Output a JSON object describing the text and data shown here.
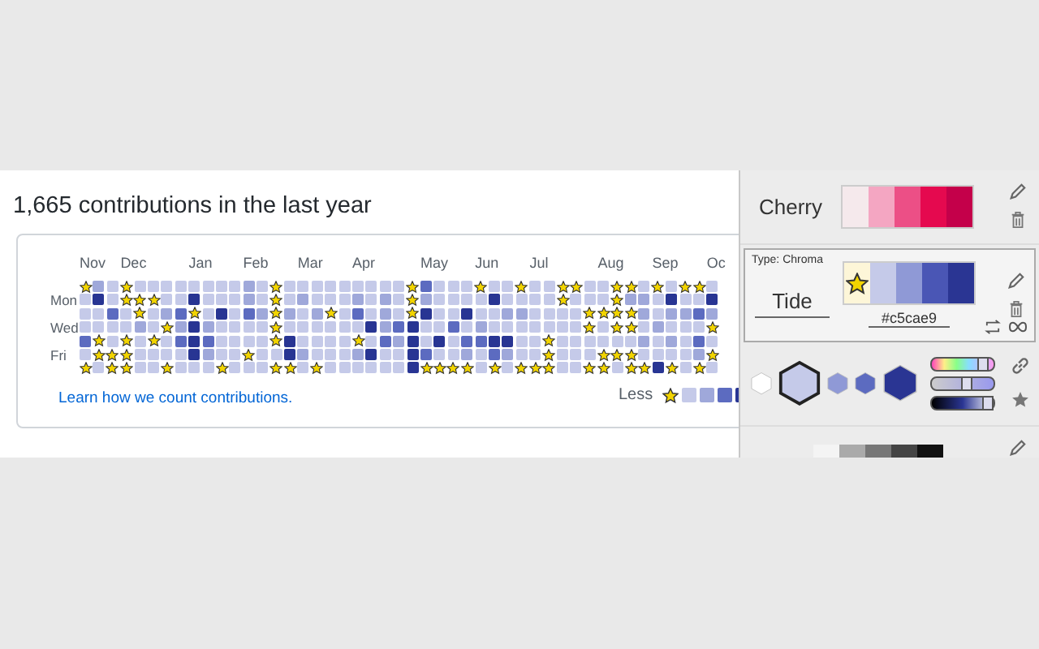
{
  "contributions": {
    "title": "1,665 contributions in the last year",
    "months": [
      "Nov",
      "Dec",
      "Jan",
      "Feb",
      "Mar",
      "Apr",
      "May",
      "Jun",
      "Jul",
      "Aug",
      "Sep",
      "Oc"
    ],
    "days": [
      "Mon",
      "Wed",
      "Fri"
    ],
    "grid": [
      {
        "cells": [
          {
            "kind": "star"
          },
          {
            "kind": "square",
            "color": "#9fa8da"
          },
          {
            "kind": "square",
            "color": "#c5cae9"
          },
          {
            "kind": "star"
          },
          {
            "kind": "square",
            "color": "#c5cae9"
          },
          {
            "kind": "square",
            "color": "#c5cae9"
          },
          {
            "kind": "square",
            "color": "#c5cae9"
          },
          {
            "kind": "square",
            "color": "#c5cae9"
          },
          {
            "kind": "square",
            "color": "#c5cae9"
          },
          {
            "kind": "square",
            "color": "#c5cae9"
          },
          {
            "kind": "square",
            "color": "#c5cae9"
          },
          {
            "kind": "square",
            "color": "#c5cae9"
          },
          {
            "kind": "square",
            "color": "#9fa8da"
          },
          {
            "kind": "square",
            "color": "#c5cae9"
          },
          {
            "kind": "star"
          },
          {
            "kind": "square",
            "color": "#c5cae9"
          },
          {
            "kind": "square",
            "color": "#c5cae9"
          },
          {
            "kind": "square",
            "color": "#c5cae9"
          },
          {
            "kind": "square",
            "color": "#c5cae9"
          },
          {
            "kind": "square",
            "color": "#c5cae9"
          },
          {
            "kind": "square",
            "color": "#c5cae9"
          },
          {
            "kind": "square",
            "color": "#c5cae9"
          },
          {
            "kind": "square",
            "color": "#c5cae9"
          },
          {
            "kind": "square",
            "color": "#c5cae9"
          },
          {
            "kind": "star"
          },
          {
            "kind": "square",
            "color": "#5c6bc0"
          },
          {
            "kind": "square",
            "color": "#c5cae9"
          },
          {
            "kind": "square",
            "color": "#c5cae9"
          },
          {
            "kind": "square",
            "color": "#c5cae9"
          },
          {
            "kind": "star"
          },
          {
            "kind": "square",
            "color": "#c5cae9"
          },
          {
            "kind": "square",
            "color": "#c5cae9"
          },
          {
            "kind": "star"
          },
          {
            "kind": "square",
            "color": "#c5cae9"
          },
          {
            "kind": "square",
            "color": "#c5cae9"
          },
          {
            "kind": "star"
          },
          {
            "kind": "star"
          },
          {
            "kind": "square",
            "color": "#c5cae9"
          },
          {
            "kind": "square",
            "color": "#c5cae9"
          },
          {
            "kind": "star"
          },
          {
            "kind": "star"
          },
          {
            "kind": "square",
            "color": "#c5cae9"
          },
          {
            "kind": "star"
          },
          {
            "kind": "square",
            "color": "#c5cae9"
          },
          {
            "kind": "star"
          },
          {
            "kind": "star"
          },
          {
            "kind": "square",
            "color": "#c5cae9"
          }
        ]
      },
      {
        "cells": [
          {
            "kind": "square",
            "color": "#c5cae9"
          },
          {
            "kind": "square",
            "color": "#283593"
          },
          {
            "kind": "square",
            "color": "#c5cae9"
          },
          {
            "kind": "star"
          },
          {
            "kind": "star"
          },
          {
            "kind": "star"
          },
          {
            "kind": "square",
            "color": "#c5cae9"
          },
          {
            "kind": "square",
            "color": "#c5cae9"
          },
          {
            "kind": "square",
            "color": "#283593"
          },
          {
            "kind": "square",
            "color": "#c5cae9"
          },
          {
            "kind": "square",
            "color": "#c5cae9"
          },
          {
            "kind": "square",
            "color": "#c5cae9"
          },
          {
            "kind": "square",
            "color": "#9fa8da"
          },
          {
            "kind": "square",
            "color": "#c5cae9"
          },
          {
            "kind": "star"
          },
          {
            "kind": "square",
            "color": "#c5cae9"
          },
          {
            "kind": "square",
            "color": "#9fa8da"
          },
          {
            "kind": "square",
            "color": "#c5cae9"
          },
          {
            "kind": "square",
            "color": "#c5cae9"
          },
          {
            "kind": "square",
            "color": "#c5cae9"
          },
          {
            "kind": "square",
            "color": "#9fa8da"
          },
          {
            "kind": "square",
            "color": "#c5cae9"
          },
          {
            "kind": "square",
            "color": "#9fa8da"
          },
          {
            "kind": "square",
            "color": "#c5cae9"
          },
          {
            "kind": "star"
          },
          {
            "kind": "square",
            "color": "#9fa8da"
          },
          {
            "kind": "square",
            "color": "#c5cae9"
          },
          {
            "kind": "square",
            "color": "#c5cae9"
          },
          {
            "kind": "square",
            "color": "#c5cae9"
          },
          {
            "kind": "square",
            "color": "#c5cae9"
          },
          {
            "kind": "square",
            "color": "#283593"
          },
          {
            "kind": "square",
            "color": "#c5cae9"
          },
          {
            "kind": "square",
            "color": "#c5cae9"
          },
          {
            "kind": "square",
            "color": "#c5cae9"
          },
          {
            "kind": "square",
            "color": "#c5cae9"
          },
          {
            "kind": "star"
          },
          {
            "kind": "square",
            "color": "#c5cae9"
          },
          {
            "kind": "square",
            "color": "#c5cae9"
          },
          {
            "kind": "square",
            "color": "#c5cae9"
          },
          {
            "kind": "star"
          },
          {
            "kind": "square",
            "color": "#9fa8da"
          },
          {
            "kind": "square",
            "color": "#9fa8da"
          },
          {
            "kind": "square",
            "color": "#c5cae9"
          },
          {
            "kind": "square",
            "color": "#283593"
          },
          {
            "kind": "square",
            "color": "#c5cae9"
          },
          {
            "kind": "square",
            "color": "#c5cae9"
          },
          {
            "kind": "square",
            "color": "#283593"
          }
        ]
      },
      {
        "cells": [
          {
            "kind": "square",
            "color": "#c5cae9"
          },
          {
            "kind": "square",
            "color": "#c5cae9"
          },
          {
            "kind": "square",
            "color": "#5c6bc0"
          },
          {
            "kind": "square",
            "color": "#c5cae9"
          },
          {
            "kind": "star"
          },
          {
            "kind": "square",
            "color": "#c5cae9"
          },
          {
            "kind": "square",
            "color": "#9fa8da"
          },
          {
            "kind": "square",
            "color": "#5c6bc0"
          },
          {
            "kind": "star"
          },
          {
            "kind": "square",
            "color": "#c5cae9"
          },
          {
            "kind": "square",
            "color": "#283593"
          },
          {
            "kind": "square",
            "color": "#c5cae9"
          },
          {
            "kind": "square",
            "color": "#5c6bc0"
          },
          {
            "kind": "square",
            "color": "#9fa8da"
          },
          {
            "kind": "star"
          },
          {
            "kind": "square",
            "color": "#9fa8da"
          },
          {
            "kind": "square",
            "color": "#c5cae9"
          },
          {
            "kind": "square",
            "color": "#9fa8da"
          },
          {
            "kind": "star"
          },
          {
            "kind": "square",
            "color": "#c5cae9"
          },
          {
            "kind": "square",
            "color": "#5c6bc0"
          },
          {
            "kind": "square",
            "color": "#c5cae9"
          },
          {
            "kind": "square",
            "color": "#9fa8da"
          },
          {
            "kind": "square",
            "color": "#c5cae9"
          },
          {
            "kind": "star"
          },
          {
            "kind": "square",
            "color": "#283593"
          },
          {
            "kind": "square",
            "color": "#c5cae9"
          },
          {
            "kind": "square",
            "color": "#c5cae9"
          },
          {
            "kind": "square",
            "color": "#283593"
          },
          {
            "kind": "square",
            "color": "#c5cae9"
          },
          {
            "kind": "square",
            "color": "#c5cae9"
          },
          {
            "kind": "square",
            "color": "#9fa8da"
          },
          {
            "kind": "square",
            "color": "#9fa8da"
          },
          {
            "kind": "square",
            "color": "#c5cae9"
          },
          {
            "kind": "square",
            "color": "#c5cae9"
          },
          {
            "kind": "square",
            "color": "#c5cae9"
          },
          {
            "kind": "square",
            "color": "#c5cae9"
          },
          {
            "kind": "star"
          },
          {
            "kind": "star"
          },
          {
            "kind": "star"
          },
          {
            "kind": "star"
          },
          {
            "kind": "square",
            "color": "#9fa8da"
          },
          {
            "kind": "square",
            "color": "#c5cae9"
          },
          {
            "kind": "square",
            "color": "#9fa8da"
          },
          {
            "kind": "square",
            "color": "#9fa8da"
          },
          {
            "kind": "square",
            "color": "#5c6bc0"
          },
          {
            "kind": "square",
            "color": "#9fa8da"
          }
        ]
      },
      {
        "cells": [
          {
            "kind": "square",
            "color": "#c5cae9"
          },
          {
            "kind": "square",
            "color": "#c5cae9"
          },
          {
            "kind": "square",
            "color": "#c5cae9"
          },
          {
            "kind": "square",
            "color": "#c5cae9"
          },
          {
            "kind": "square",
            "color": "#9fa8da"
          },
          {
            "kind": "square",
            "color": "#c5cae9"
          },
          {
            "kind": "star"
          },
          {
            "kind": "square",
            "color": "#9fa8da"
          },
          {
            "kind": "square",
            "color": "#283593"
          },
          {
            "kind": "square",
            "color": "#9fa8da"
          },
          {
            "kind": "square",
            "color": "#c5cae9"
          },
          {
            "kind": "square",
            "color": "#c5cae9"
          },
          {
            "kind": "square",
            "color": "#c5cae9"
          },
          {
            "kind": "square",
            "color": "#c5cae9"
          },
          {
            "kind": "star"
          },
          {
            "kind": "square",
            "color": "#c5cae9"
          },
          {
            "kind": "square",
            "color": "#c5cae9"
          },
          {
            "kind": "square",
            "color": "#c5cae9"
          },
          {
            "kind": "square",
            "color": "#c5cae9"
          },
          {
            "kind": "square",
            "color": "#c5cae9"
          },
          {
            "kind": "square",
            "color": "#c5cae9"
          },
          {
            "kind": "square",
            "color": "#283593"
          },
          {
            "kind": "square",
            "color": "#9fa8da"
          },
          {
            "kind": "square",
            "color": "#5c6bc0"
          },
          {
            "kind": "square",
            "color": "#283593"
          },
          {
            "kind": "square",
            "color": "#c5cae9"
          },
          {
            "kind": "square",
            "color": "#c5cae9"
          },
          {
            "kind": "square",
            "color": "#5c6bc0"
          },
          {
            "kind": "square",
            "color": "#c5cae9"
          },
          {
            "kind": "square",
            "color": "#9fa8da"
          },
          {
            "kind": "square",
            "color": "#c5cae9"
          },
          {
            "kind": "square",
            "color": "#c5cae9"
          },
          {
            "kind": "square",
            "color": "#c5cae9"
          },
          {
            "kind": "square",
            "color": "#c5cae9"
          },
          {
            "kind": "square",
            "color": "#c5cae9"
          },
          {
            "kind": "square",
            "color": "#c5cae9"
          },
          {
            "kind": "square",
            "color": "#c5cae9"
          },
          {
            "kind": "star"
          },
          {
            "kind": "square",
            "color": "#c5cae9"
          },
          {
            "kind": "star"
          },
          {
            "kind": "star"
          },
          {
            "kind": "square",
            "color": "#c5cae9"
          },
          {
            "kind": "square",
            "color": "#9fa8da"
          },
          {
            "kind": "square",
            "color": "#c5cae9"
          },
          {
            "kind": "square",
            "color": "#c5cae9"
          },
          {
            "kind": "square",
            "color": "#c5cae9"
          },
          {
            "kind": "star"
          }
        ]
      },
      {
        "cells": [
          {
            "kind": "square",
            "color": "#5c6bc0"
          },
          {
            "kind": "star"
          },
          {
            "kind": "square",
            "color": "#c5cae9"
          },
          {
            "kind": "star"
          },
          {
            "kind": "square",
            "color": "#c5cae9"
          },
          {
            "kind": "star"
          },
          {
            "kind": "square",
            "color": "#c5cae9"
          },
          {
            "kind": "square",
            "color": "#5c6bc0"
          },
          {
            "kind": "square",
            "color": "#283593"
          },
          {
            "kind": "square",
            "color": "#5c6bc0"
          },
          {
            "kind": "square",
            "color": "#c5cae9"
          },
          {
            "kind": "square",
            "color": "#c5cae9"
          },
          {
            "kind": "square",
            "color": "#c5cae9"
          },
          {
            "kind": "square",
            "color": "#c5cae9"
          },
          {
            "kind": "star"
          },
          {
            "kind": "square",
            "color": "#283593"
          },
          {
            "kind": "square",
            "color": "#c5cae9"
          },
          {
            "kind": "square",
            "color": "#c5cae9"
          },
          {
            "kind": "square",
            "color": "#c5cae9"
          },
          {
            "kind": "square",
            "color": "#c5cae9"
          },
          {
            "kind": "star"
          },
          {
            "kind": "square",
            "color": "#c5cae9"
          },
          {
            "kind": "square",
            "color": "#5c6bc0"
          },
          {
            "kind": "square",
            "color": "#9fa8da"
          },
          {
            "kind": "square",
            "color": "#283593"
          },
          {
            "kind": "square",
            "color": "#c5cae9"
          },
          {
            "kind": "square",
            "color": "#283593"
          },
          {
            "kind": "square",
            "color": "#c5cae9"
          },
          {
            "kind": "square",
            "color": "#5c6bc0"
          },
          {
            "kind": "square",
            "color": "#5c6bc0"
          },
          {
            "kind": "square",
            "color": "#283593"
          },
          {
            "kind": "square",
            "color": "#283593"
          },
          {
            "kind": "square",
            "color": "#c5cae9"
          },
          {
            "kind": "square",
            "color": "#c5cae9"
          },
          {
            "kind": "star"
          },
          {
            "kind": "square",
            "color": "#c5cae9"
          },
          {
            "kind": "square",
            "color": "#c5cae9"
          },
          {
            "kind": "square",
            "color": "#c5cae9"
          },
          {
            "kind": "square",
            "color": "#c5cae9"
          },
          {
            "kind": "square",
            "color": "#c5cae9"
          },
          {
            "kind": "square",
            "color": "#c5cae9"
          },
          {
            "kind": "square",
            "color": "#9fa8da"
          },
          {
            "kind": "square",
            "color": "#c5cae9"
          },
          {
            "kind": "square",
            "color": "#9fa8da"
          },
          {
            "kind": "square",
            "color": "#c5cae9"
          },
          {
            "kind": "square",
            "color": "#5c6bc0"
          },
          {
            "kind": "square",
            "color": "#c5cae9"
          }
        ]
      },
      {
        "cells": [
          {
            "kind": "square",
            "color": "#c5cae9"
          },
          {
            "kind": "star"
          },
          {
            "kind": "star"
          },
          {
            "kind": "star"
          },
          {
            "kind": "square",
            "color": "#c5cae9"
          },
          {
            "kind": "square",
            "color": "#c5cae9"
          },
          {
            "kind": "square",
            "color": "#c5cae9"
          },
          {
            "kind": "square",
            "color": "#c5cae9"
          },
          {
            "kind": "square",
            "color": "#283593"
          },
          {
            "kind": "square",
            "color": "#9fa8da"
          },
          {
            "kind": "square",
            "color": "#c5cae9"
          },
          {
            "kind": "square",
            "color": "#c5cae9"
          },
          {
            "kind": "star"
          },
          {
            "kind": "square",
            "color": "#c5cae9"
          },
          {
            "kind": "square",
            "color": "#c5cae9"
          },
          {
            "kind": "square",
            "color": "#283593"
          },
          {
            "kind": "square",
            "color": "#9fa8da"
          },
          {
            "kind": "square",
            "color": "#c5cae9"
          },
          {
            "kind": "square",
            "color": "#c5cae9"
          },
          {
            "kind": "square",
            "color": "#c5cae9"
          },
          {
            "kind": "square",
            "color": "#9fa8da"
          },
          {
            "kind": "square",
            "color": "#283593"
          },
          {
            "kind": "square",
            "color": "#c5cae9"
          },
          {
            "kind": "square",
            "color": "#c5cae9"
          },
          {
            "kind": "square",
            "color": "#283593"
          },
          {
            "kind": "square",
            "color": "#5c6bc0"
          },
          {
            "kind": "square",
            "color": "#c5cae9"
          },
          {
            "kind": "square",
            "color": "#c5cae9"
          },
          {
            "kind": "square",
            "color": "#9fa8da"
          },
          {
            "kind": "square",
            "color": "#c5cae9"
          },
          {
            "kind": "square",
            "color": "#5c6bc0"
          },
          {
            "kind": "square",
            "color": "#9fa8da"
          },
          {
            "kind": "square",
            "color": "#c5cae9"
          },
          {
            "kind": "square",
            "color": "#c5cae9"
          },
          {
            "kind": "star"
          },
          {
            "kind": "square",
            "color": "#c5cae9"
          },
          {
            "kind": "square",
            "color": "#c5cae9"
          },
          {
            "kind": "square",
            "color": "#c5cae9"
          },
          {
            "kind": "star"
          },
          {
            "kind": "star"
          },
          {
            "kind": "star"
          },
          {
            "kind": "square",
            "color": "#c5cae9"
          },
          {
            "kind": "square",
            "color": "#c5cae9"
          },
          {
            "kind": "square",
            "color": "#c5cae9"
          },
          {
            "kind": "square",
            "color": "#c5cae9"
          },
          {
            "kind": "square",
            "color": "#9fa8da"
          },
          {
            "kind": "star"
          }
        ]
      },
      {
        "cells": [
          {
            "kind": "star"
          },
          {
            "kind": "square",
            "color": "#c5cae9"
          },
          {
            "kind": "star"
          },
          {
            "kind": "star"
          },
          {
            "kind": "square",
            "color": "#c5cae9"
          },
          {
            "kind": "square",
            "color": "#c5cae9"
          },
          {
            "kind": "star"
          },
          {
            "kind": "square",
            "color": "#c5cae9"
          },
          {
            "kind": "square",
            "color": "#c5cae9"
          },
          {
            "kind": "square",
            "color": "#c5cae9"
          },
          {
            "kind": "star"
          },
          {
            "kind": "square",
            "color": "#c5cae9"
          },
          {
            "kind": "square",
            "color": "#c5cae9"
          },
          {
            "kind": "square",
            "color": "#c5cae9"
          },
          {
            "kind": "star"
          },
          {
            "kind": "star"
          },
          {
            "kind": "square",
            "color": "#c5cae9"
          },
          {
            "kind": "star"
          },
          {
            "kind": "square",
            "color": "#c5cae9"
          },
          {
            "kind": "square",
            "color": "#c5cae9"
          },
          {
            "kind": "square",
            "color": "#c5cae9"
          },
          {
            "kind": "square",
            "color": "#c5cae9"
          },
          {
            "kind": "square",
            "color": "#c5cae9"
          },
          {
            "kind": "square",
            "color": "#c5cae9"
          },
          {
            "kind": "square",
            "color": "#283593"
          },
          {
            "kind": "star"
          },
          {
            "kind": "star"
          },
          {
            "kind": "star"
          },
          {
            "kind": "star"
          },
          {
            "kind": "square",
            "color": "#c5cae9"
          },
          {
            "kind": "star"
          },
          {
            "kind": "square",
            "color": "#c5cae9"
          },
          {
            "kind": "star"
          },
          {
            "kind": "star"
          },
          {
            "kind": "star"
          },
          {
            "kind": "square",
            "color": "#c5cae9"
          },
          {
            "kind": "square",
            "color": "#c5cae9"
          },
          {
            "kind": "star"
          },
          {
            "kind": "star"
          },
          {
            "kind": "square",
            "color": "#c5cae9"
          },
          {
            "kind": "star"
          },
          {
            "kind": "star"
          },
          {
            "kind": "square",
            "color": "#283593"
          },
          {
            "kind": "star"
          },
          {
            "kind": "square",
            "color": "#c5cae9"
          },
          {
            "kind": "star"
          },
          {
            "kind": "square",
            "color": "#c5cae9"
          }
        ]
      }
    ],
    "link": "Learn how we count contributions.",
    "legend": {
      "less": "Less",
      "levels": [
        {
          "kind": "star"
        },
        {
          "kind": "square",
          "color": "#c5cae9"
        },
        {
          "kind": "square",
          "color": "#9fa8da"
        },
        {
          "kind": "square",
          "color": "#5c6bc0"
        },
        {
          "kind": "square",
          "color": "#283593"
        }
      ]
    }
  },
  "palettes": [
    {
      "name": "Cherry",
      "selected": false,
      "swatches": [
        {
          "color": "#f5e9ec"
        },
        {
          "color": "#f4a6c2"
        },
        {
          "color": "#ec4f86"
        },
        {
          "color": "#e5094f"
        },
        {
          "color": "#c4004a"
        }
      ]
    },
    {
      "name": "Tide",
      "type": "Type: Chroma",
      "selected": true,
      "hex": "#c5cae9",
      "swatches": [
        {
          "color": "#fdf6d8"
        },
        {
          "color": "#c5cae9"
        },
        {
          "color": "#8f99d6"
        },
        {
          "color": "#4a56b5"
        },
        {
          "color": "#2a3593"
        }
      ]
    }
  ],
  "editor": {
    "hexes": [
      {
        "color": "#ffffff",
        "selected": false
      },
      {
        "color": "#c5cae9",
        "selected": true
      },
      {
        "color": "#8f99d6",
        "selected": false
      },
      {
        "color": "#5c6bc0",
        "selected": false
      },
      {
        "color": "#2a3593",
        "selected": false
      }
    ],
    "sliders": [
      {
        "kind": "hue",
        "level": 0.82
      },
      {
        "kind": "saturation",
        "level": 0.55
      },
      {
        "kind": "lightness",
        "level": 0.9
      }
    ]
  },
  "next_palette": {
    "swatches": [
      {
        "color": "#f4f4f4"
      },
      {
        "color": "#aaaaaa"
      },
      {
        "color": "#777777"
      },
      {
        "color": "#444444"
      },
      {
        "color": "#111111"
      }
    ]
  }
}
